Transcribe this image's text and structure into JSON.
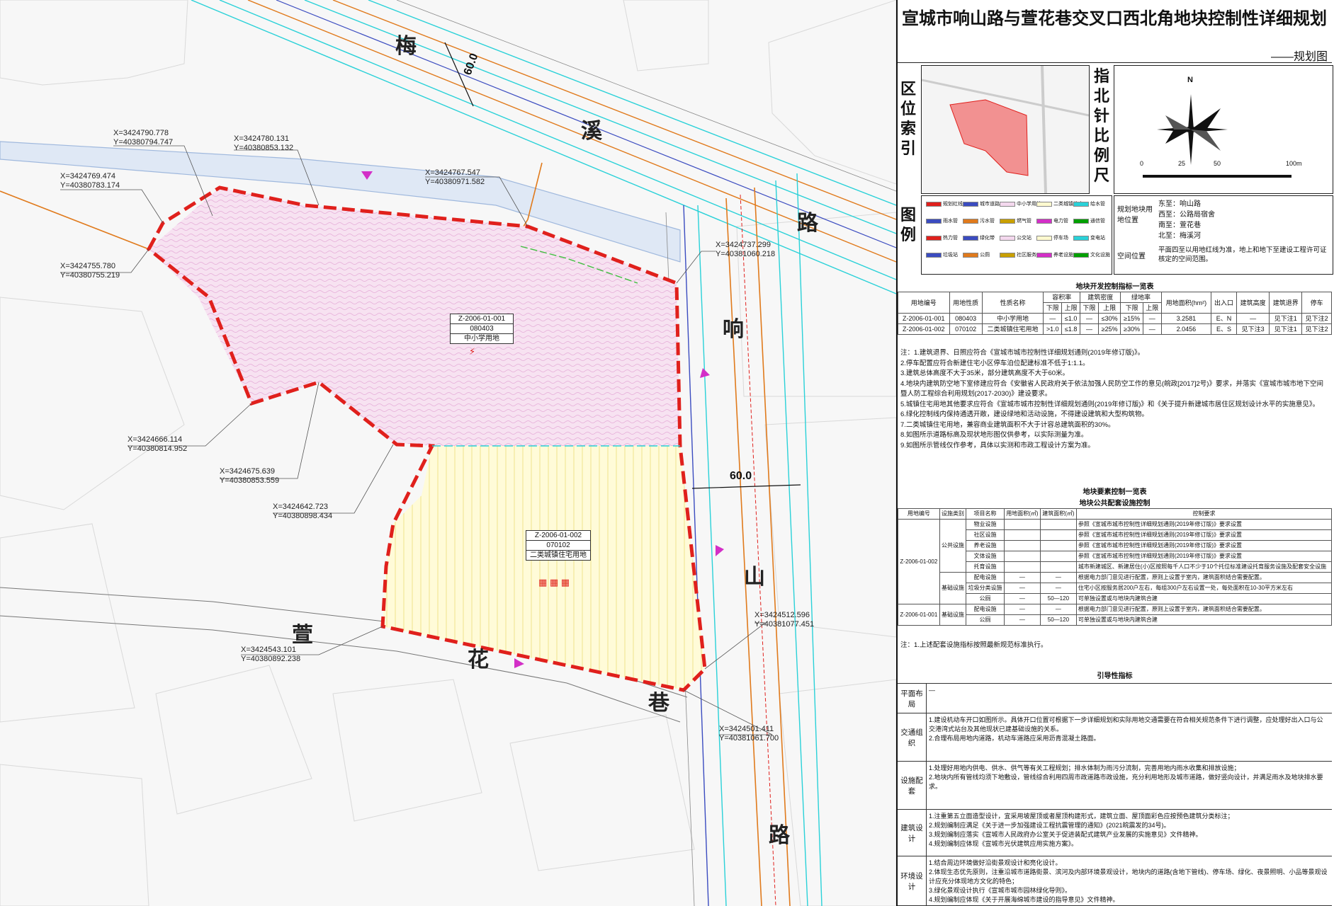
{
  "title": "宣城市响山路与萱花巷交叉口西北角地块控制性详细规划",
  "subtitle": "——规划图",
  "map": {
    "roads": [
      "梅",
      "溪",
      "路",
      "响",
      "山",
      "路",
      "萱",
      "花",
      "巷"
    ],
    "road_width_north": "60.0",
    "road_width_east": "60.0",
    "coordinates": [
      {
        "x": "X=3424790.778",
        "y": "Y=40380794.747"
      },
      {
        "x": "X=3424780.131",
        "y": "Y=40380853.132"
      },
      {
        "x": "X=3424769.474",
        "y": "Y=40380783.174"
      },
      {
        "x": "X=3424767.547",
        "y": "Y=40380971.582"
      },
      {
        "x": "X=3424755.780",
        "y": "Y=40380755.219"
      },
      {
        "x": "X=3424737.299",
        "y": "Y=40381060.218"
      },
      {
        "x": "X=3424666.114",
        "y": "Y=40380814.952"
      },
      {
        "x": "X=3424675.639",
        "y": "Y=40380853.559"
      },
      {
        "x": "X=3424642.723",
        "y": "Y=40380898.434"
      },
      {
        "x": "X=3424512.596",
        "y": "Y=40381077.451"
      },
      {
        "x": "X=3424543.101",
        "y": "Y=40380892.238"
      },
      {
        "x": "X=3424501.411",
        "y": "Y=40381061.700"
      }
    ],
    "plot1": {
      "id": "Z-2006-01-001",
      "code": "080403",
      "name": "中小学用地"
    },
    "plot2": {
      "id": "Z-2006-01-002",
      "code": "070102",
      "name": "二类城镇住宅用地"
    }
  },
  "index": {
    "location_label": "区位索引",
    "north_label": "指北针比例尺",
    "north": "N",
    "scale": [
      "0",
      "25",
      "50",
      "100m"
    ]
  },
  "legend": {
    "label": "图例",
    "items": [
      "规划红线",
      "城市道路",
      "中小学用地",
      "二类城镇住宅",
      "给水管",
      "雨水管",
      "污水管",
      "燃气管",
      "电力管",
      "通信管",
      "热力管",
      "绿化带",
      "公交站",
      "停车场",
      "变电站",
      "垃圾站",
      "公厕",
      "社区服务",
      "养老设施",
      "文化设施"
    ],
    "boundary_label": "规划地块用地位置",
    "boundaries": [
      {
        "k": "东至",
        "v": "响山路"
      },
      {
        "k": "西至",
        "v": "公路局宿舍"
      },
      {
        "k": "南至",
        "v": "萱花巷"
      },
      {
        "k": "北至",
        "v": "梅溪河"
      }
    ],
    "space_label": "空间位置",
    "space_text": "平面四至以用地红线为准，地上和地下至建设工程许可证核定的空间范围。"
  },
  "control_table": {
    "title": "地块开发控制指标一览表",
    "head1": [
      "用地编号",
      "用地性质",
      "性质名称",
      "容积率",
      "建筑密度",
      "绿地率",
      "用地面积(hm²)",
      "出入口",
      "建筑高度",
      "建筑退界",
      "停车"
    ],
    "head2": [
      "下限",
      "上限",
      "下限",
      "上限",
      "下限",
      "上限"
    ],
    "rows": [
      [
        "Z-2006-01-001",
        "080403",
        "中小学用地",
        "—",
        "≤1.0",
        "—",
        "≤30%",
        "≥15%",
        "—",
        "3.2581",
        "E、N",
        "—",
        "见下注1",
        "见下注2"
      ],
      [
        "Z-2006-01-002",
        "070102",
        "二类城镇住宅用地",
        ">1.0",
        "≤1.8",
        "—",
        "≥25%",
        "≥30%",
        "—",
        "2.0456",
        "E、S",
        "见下注3",
        "见下注1",
        "见下注2"
      ]
    ]
  },
  "notes": [
    "注：1.建筑退界、日照应符合《宣城市城市控制性详细规划通则(2019年修订版)》。",
    "2.停车配置应符合新建住宅小区停车泊位配建标准不低于1:1.1。",
    "3.建筑总体高度不大于35米，部分建筑高度不大于60米。",
    "4.地块内建筑防空地下室修建应符合《安徽省人民政府关于依法加强人民防空工作的意见(皖政[2017]2号)》要求，并落实《宣城市城市地下空间暨人防工程综合利用规划(2017-2030)》建设要求。",
    "5.城镇住宅用地其他要求应符合《宣城市城市控制性详细规划通则(2019年修订版)》和《关于提升新建城市居住区规划设计水平的实施意见》。",
    "6.绿化控制线内保持通透开敞，建设绿地和活动设施，不得建设建筑和大型构筑物。",
    "7.二类城镇住宅用地，兼容商业建筑面积不大于计容总建筑面积的30%。",
    "8.如图所示道路标高及现状地形图仅供参考，以实际测量为准。",
    "9.如图所示管线仅作参考，具体以实测和市政工程设计方案为准。"
  ],
  "facility_table": {
    "title": "地块要素控制一览表",
    "subtitle": "地块公共配套设施控制",
    "head": [
      "用地编号",
      "设施类别",
      "项目名称",
      "用地面积(㎡)",
      "建筑面积(㎡)",
      "控制要求"
    ],
    "plot2_id": "Z-2006-01-002",
    "plot1_id": "Z-2006-01-001",
    "public_label": "公共设施",
    "base_label": "基础设施",
    "rows_public": [
      [
        "物业设施",
        "参照《宣城市城市控制性详细规划通则(2019年修订版)》要求设置"
      ],
      [
        "社区设施",
        "参照《宣城市城市控制性详细规划通则(2019年修订版)》要求设置"
      ],
      [
        "养老设施",
        "参照《宣城市城市控制性详细规划通则(2019年修订版)》要求设置"
      ],
      [
        "文体设施",
        "参照《宣城市城市控制性详细规划通则(2019年修订版)》要求设置"
      ],
      [
        "托育设施",
        "城市新建城区、新建居住(小)区按照每千人口不少于10个托位标准建设托育服务设施及配套安全设施"
      ]
    ],
    "rows_base": [
      [
        "配电设施",
        "—",
        "—",
        "根据电力部门意见进行配置，原则上设置于室内，建筑面积结合需要配置。"
      ],
      [
        "垃圾分类设施",
        "—",
        "—",
        "住宅小区按服务居200户左右，每组300户左右设置一处，每处面积在10-30平方米左右"
      ],
      [
        "公厕",
        "—",
        "50—120",
        "可单独设置或与地块内建筑合建"
      ]
    ],
    "rows_plot1": [
      [
        "配电设施",
        "—",
        "—",
        "根据电力部门意见进行配置，原则上设置于室内，建筑面积结合需要配置。"
      ],
      [
        "公厕",
        "—",
        "50—120",
        "可单独设置或与地块内建筑合建"
      ]
    ],
    "note": "注：1.上述配套设施指标按照最新规范标准执行。"
  },
  "guide": {
    "title": "引导性指标",
    "rows": [
      {
        "head": "平面布局",
        "text": "—"
      },
      {
        "head": "交通组织",
        "text": "1.建设机动车开口如图所示。具体开口位置可根据下一步详细规划和实际用地交通需要在符合相关规范条件下进行调整，应处理好出入口与公交港湾式站台及其他现状已建基础设施的关系。\n2.合理布局用地内道路，机动车道路应采用沥青混凝土路面。"
      },
      {
        "head": "设施配套",
        "text": "1.处理好用地内供电、供水、供气等有关工程规划；排水体制为雨污分流制，完善用地内雨水收集和排放设施；\n2.地块内所有管线均须下地敷设，管线综合利用四周市政道路市政设施，充分利用地形及城市道路，做好竖向设计，并满足雨水及地块排水要求。"
      },
      {
        "head": "建筑设计",
        "text": "1.注重第五立面造型设计，宜采用坡屋顶或者屋顶构建形式，建筑立面、屋顶面彩色应按预色建筑分类标注；\n2.规划编制应满足《关于进一步加强建设工程抗震管理的通知》(2021皖震发的34号)。\n3.规划编制应落实《宣城市人民政府办公室关于促进装配式建筑产业发展的实施意见》文件精神。\n4.规划编制应体现《宣城市光伏建筑应用实施方案》。"
      },
      {
        "head": "环境设计",
        "text": "1.结合周边环境做好沿街景观设计和亮化设计。\n2.体现生态优先原则，注重沿城市道路街景、滨河及内部环境景观设计，地块内的道路(含地下管线)、停车场、绿化、夜景照明、小品等景观设计应充分体现地方文化的特色；\n3.绿化景观设计执行《宣城市城市园林绿化导则》。\n4.规划编制应体现《关于开展海绵城市建设的指导意见》文件精神。"
      }
    ]
  },
  "colors": {
    "redline": "#e0201c",
    "river": "#9fb8dd",
    "water_pipe": "#2ad1d8",
    "sewer": "#e07a1c",
    "plot1": "#f4d8ee",
    "plot2": "#fff9cf"
  }
}
